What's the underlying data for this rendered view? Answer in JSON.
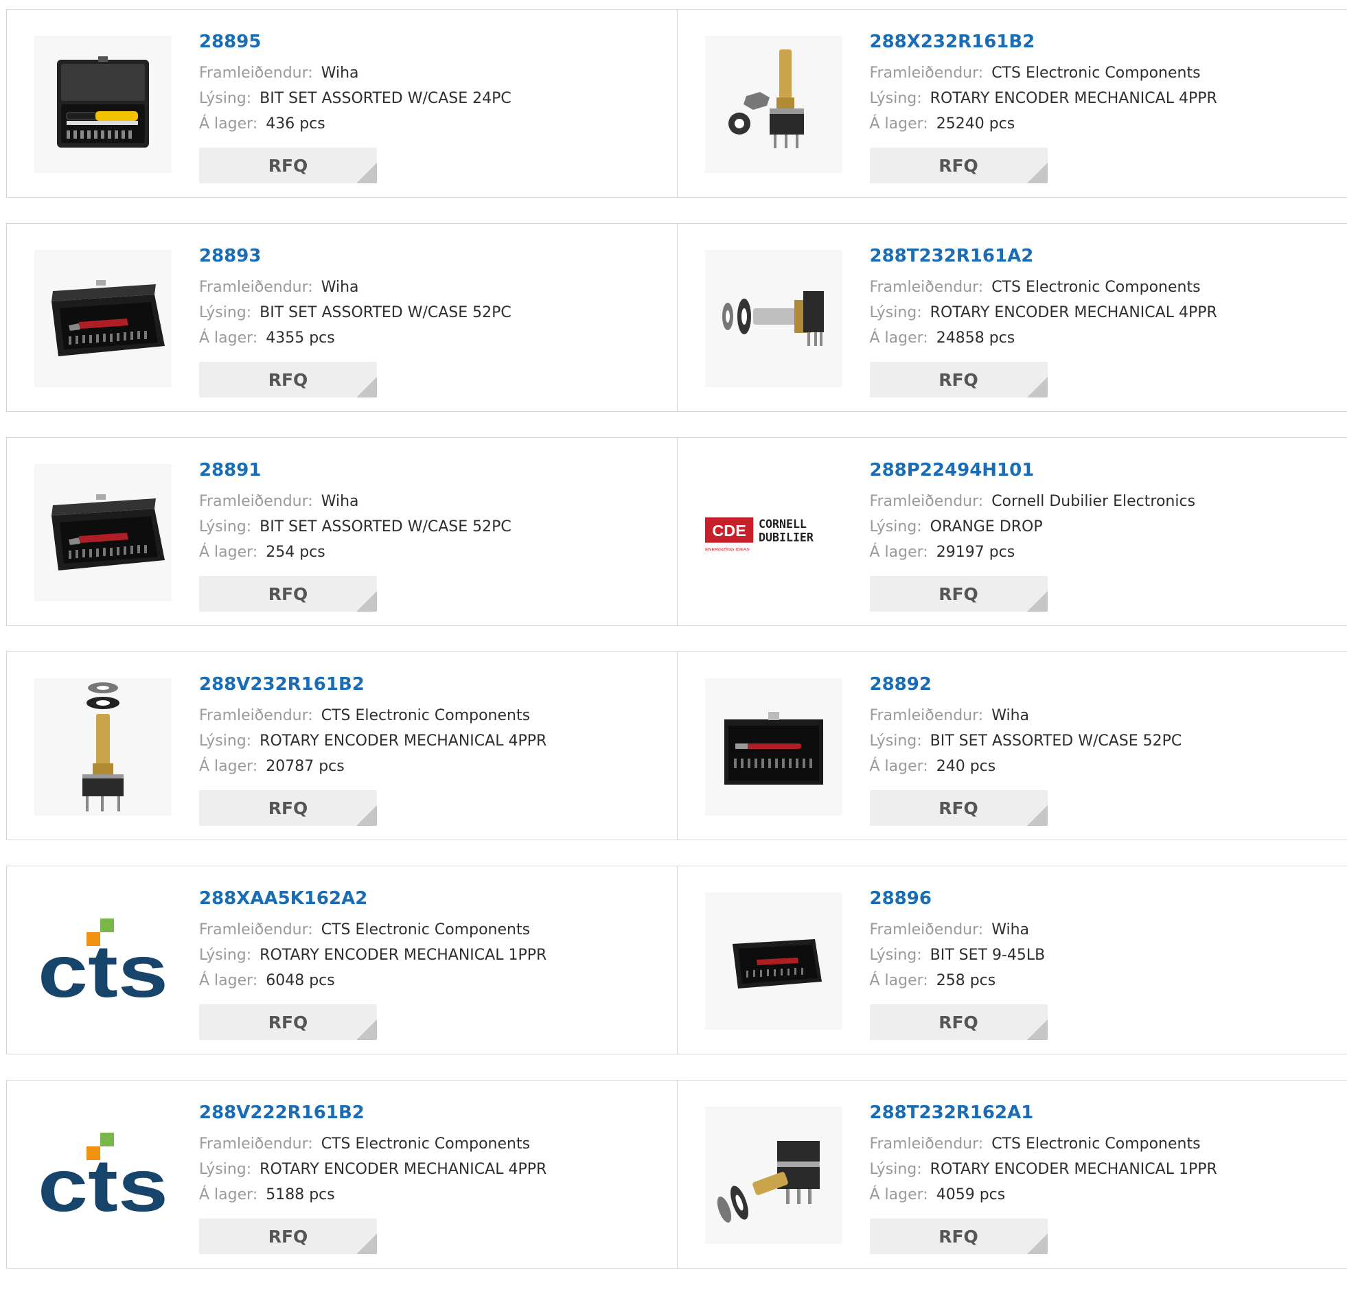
{
  "labels": {
    "manufacturer": "Framleiðendur:",
    "description": "Lýsing:",
    "stock": "Á lager:",
    "rfq": "RFQ"
  },
  "colors": {
    "link": "#1a6db5",
    "label": "#9a9a9a",
    "value": "#2e2e2e",
    "button_bg": "#eeeeee",
    "cts_blue": "#16446b",
    "cts_green": "#7ab648",
    "cts_orange": "#f29111",
    "cde_red": "#c8202a"
  },
  "products": [
    {
      "part": "28895",
      "manufacturer": "Wiha",
      "description": "BIT SET ASSORTED W/CASE 24PC",
      "stock": "436 pcs",
      "image": "bit-set-open-case"
    },
    {
      "part": "288X232R161B2",
      "manufacturer": "CTS Electronic Components",
      "description": "ROTARY ENCODER MECHANICAL 4PPR",
      "stock": "25240 pcs",
      "image": "rotary-encoder-vertical"
    },
    {
      "part": "28893",
      "manufacturer": "Wiha",
      "description": "BIT SET ASSORTED W/CASE 52PC",
      "stock": "4355 pcs",
      "image": "bit-set-metal-case"
    },
    {
      "part": "288T232R161A2",
      "manufacturer": "CTS Electronic Components",
      "description": "ROTARY ENCODER MECHANICAL 4PPR",
      "stock": "24858 pcs",
      "image": "rotary-encoder-horizontal"
    },
    {
      "part": "28891",
      "manufacturer": "Wiha",
      "description": "BIT SET ASSORTED W/CASE 52PC",
      "stock": "254 pcs",
      "image": "bit-set-metal-case"
    },
    {
      "part": "288P22494H101",
      "manufacturer": "Cornell Dubilier Electronics",
      "description": "ORANGE DROP",
      "stock": "29197 pcs",
      "image": "cde-logo",
      "logo_text": {
        "mark": "CDE",
        "line1": "CORNELL",
        "line2": "DUBILIER",
        "tagline": "ENERGIZING IDEAS"
      }
    },
    {
      "part": "288V232R161B2",
      "manufacturer": "CTS Electronic Components",
      "description": "ROTARY ENCODER MECHANICAL 4PPR",
      "stock": "20787 pcs",
      "image": "rotary-encoder-exploded"
    },
    {
      "part": "28892",
      "manufacturer": "Wiha",
      "description": "BIT SET ASSORTED W/CASE 52PC",
      "stock": "240 pcs",
      "image": "bit-set-metal-case-front"
    },
    {
      "part": "288XAA5K162A2",
      "manufacturer": "CTS Electronic Components",
      "description": "ROTARY ENCODER MECHANICAL 1PPR",
      "stock": "6048 pcs",
      "image": "cts-logo",
      "logo_text": "CTS"
    },
    {
      "part": "28896",
      "manufacturer": "Wiha",
      "description": "BIT SET 9-45LB",
      "stock": "258 pcs",
      "image": "bit-set-metal-case-small"
    },
    {
      "part": "288V222R161B2",
      "manufacturer": "CTS Electronic Components",
      "description": "ROTARY ENCODER MECHANICAL 4PPR",
      "stock": "5188 pcs",
      "image": "cts-logo",
      "logo_text": "CTS"
    },
    {
      "part": "288T232R162A1",
      "manufacturer": "CTS Electronic Components",
      "description": "ROTARY ENCODER MECHANICAL 1PPR",
      "stock": "4059 pcs",
      "image": "rotary-encoder-dual"
    }
  ]
}
